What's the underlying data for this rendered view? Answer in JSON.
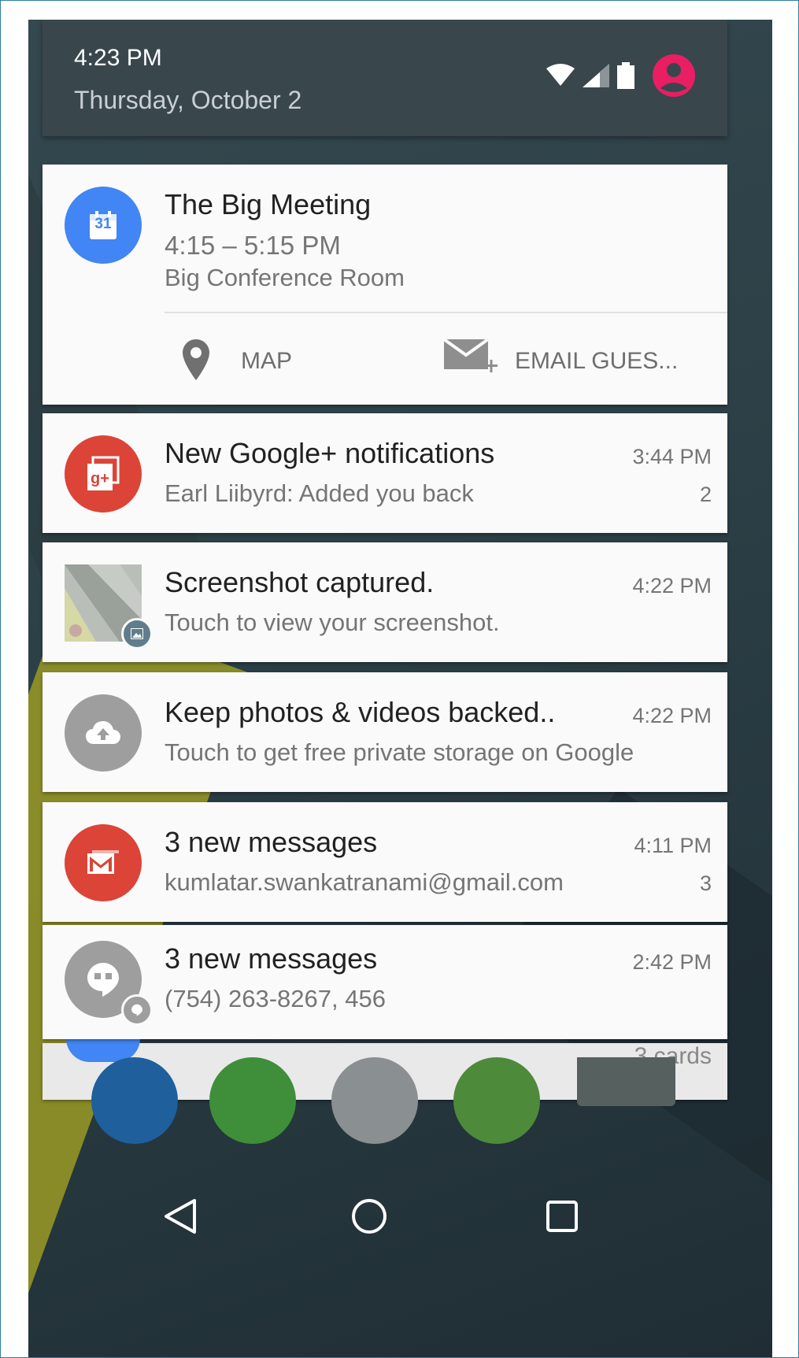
{
  "header": {
    "time": "4:23 PM",
    "date": "Thursday, October 2",
    "status_icons": [
      "wifi-icon",
      "cell-signal-icon",
      "battery-icon",
      "account-icon"
    ],
    "accent_color": "#e91e63"
  },
  "calendar_card": {
    "icon": "calendar-icon",
    "icon_day": "31",
    "icon_color": "#4285f4",
    "title": "The Big Meeting",
    "time_range": "4:15 – 5:15 PM",
    "location": "Big Conference Room",
    "actions": [
      {
        "icon": "map-pin-icon",
        "label": "MAP"
      },
      {
        "icon": "email-add-icon",
        "label": "EMAIL GUES..."
      }
    ]
  },
  "notifications": [
    {
      "icon": "google-plus-icon",
      "icon_color": "#db4437",
      "title": "New Google+ notifications",
      "time": "3:44 PM",
      "text": "Earl Liibyrd: Added you back",
      "count": "2"
    },
    {
      "icon": "screenshot-thumbnail",
      "title": "Screenshot captured.",
      "time": "4:22 PM",
      "text": "Touch to view your screenshot."
    },
    {
      "icon": "cloud-upload-icon",
      "icon_color": "#9e9e9e",
      "title": "Keep photos & videos backed..",
      "time": "4:22 PM",
      "text": "Touch to get free private storage on Google"
    },
    {
      "icon": "gmail-icon",
      "icon_color": "#db4437",
      "title": "3 new messages",
      "time": "4:11 PM",
      "text": "kumlatar.swankatranami@gmail.com",
      "count": "3"
    },
    {
      "icon": "hangouts-icon",
      "icon_color": "#9e9e9e",
      "title": "3 new messages",
      "time": "2:42 PM",
      "text": "(754) 263-8267, 456"
    }
  ],
  "stack_label": "3 cards",
  "navigation": [
    "back-icon",
    "home-icon",
    "recents-icon"
  ]
}
